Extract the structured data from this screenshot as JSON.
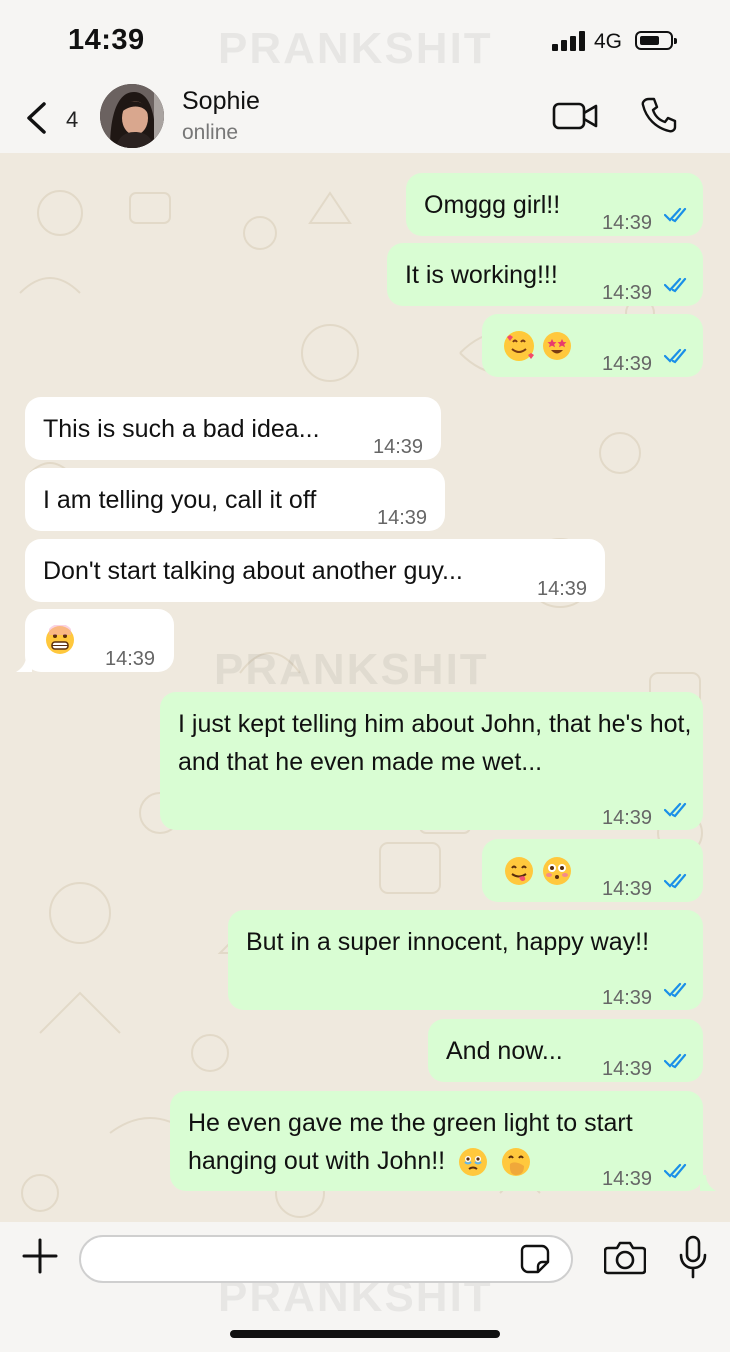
{
  "status": {
    "time": "14:39",
    "network": "4G"
  },
  "watermark": "PRANKSHIT",
  "header": {
    "back_count": "4",
    "contact_name": "Sophie",
    "presence": "online"
  },
  "messages": [
    {
      "dir": "out",
      "text": "Omggg girl!!",
      "time": "14:39",
      "read": true
    },
    {
      "dir": "out",
      "text": "It is working!!!",
      "time": "14:39",
      "read": true
    },
    {
      "dir": "out",
      "emojis": [
        "smiling-face-with-hearts",
        "star-struck"
      ],
      "time": "14:39",
      "read": true
    },
    {
      "dir": "in",
      "text": "This is such a bad idea...",
      "time": "14:39"
    },
    {
      "dir": "in",
      "text": "I am telling you, call it off",
      "time": "14:39"
    },
    {
      "dir": "in",
      "text": "Don't start talking about another guy...",
      "time": "14:39"
    },
    {
      "dir": "in",
      "emojis": [
        "grimacing-face"
      ],
      "time": "14:39"
    },
    {
      "dir": "out",
      "text": "I just kept telling him about John, that he's hot, and that he even made me wet...",
      "time": "14:39",
      "read": true
    },
    {
      "dir": "out",
      "emojis": [
        "face-savoring-food",
        "flushed-face"
      ],
      "time": "14:39",
      "read": true
    },
    {
      "dir": "out",
      "text": "But in a super innocent, happy way!!",
      "time": "14:39",
      "read": true
    },
    {
      "dir": "out",
      "text": "And now...",
      "time": "14:39",
      "read": true
    },
    {
      "dir": "out",
      "text": "He even gave me the green light to start hanging out with John!!",
      "emojis": [
        "face-holding-back-tears",
        "face-with-hand-over-mouth"
      ],
      "time": "14:39",
      "read": true
    }
  ],
  "input": {
    "placeholder": ""
  },
  "colors": {
    "outgoing_bubble": "#d9fdd3",
    "incoming_bubble": "#ffffff",
    "chat_background": "#efe9de",
    "read_ticks": "#1a8fe8"
  }
}
